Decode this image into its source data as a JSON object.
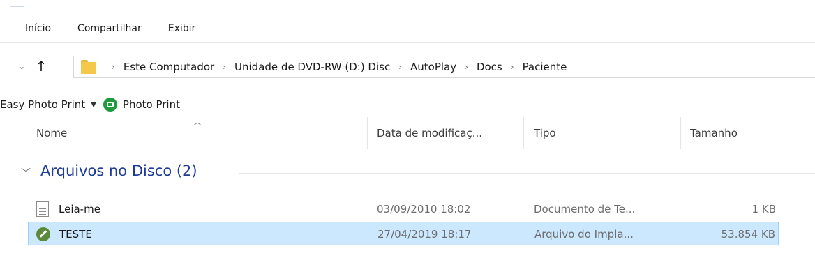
{
  "ribbon": {
    "tabs": [
      "Início",
      "Compartilhar",
      "Exibir"
    ]
  },
  "navigation": {
    "dropdown_icon": "chevron-down-icon",
    "up_icon": "up-arrow-icon",
    "breadcrumbs": [
      "Este Computador",
      "Unidade de DVD-RW (D:) Disc",
      "AutoPlay",
      "Docs",
      "Paciente"
    ]
  },
  "toolbar": {
    "easy_photo_print_label": "Easy Photo Print",
    "photo_print_label": "Photo Print",
    "photo_print_color": "#1e9b3c"
  },
  "columns": {
    "name": "Nome",
    "date": "Data de modificaç...",
    "type": "Tipo",
    "size": "Tamanho"
  },
  "group": {
    "title": "Arquivos no Disco (2)",
    "color": "#1f3b99"
  },
  "files": [
    {
      "name": "Leia-me",
      "date": "03/09/2010 18:02",
      "type": "Documento de Te...",
      "size": "1 KB",
      "icon": "text-document-icon",
      "selected": false
    },
    {
      "name": "TESTE",
      "date": "27/04/2019 18:17",
      "type": "Arquivo do Impla...",
      "size": "53.854 KB",
      "icon": "implant-file-icon",
      "selected": true
    }
  ],
  "colors": {
    "selection_bg": "#cce8ff",
    "selection_border": "#99d1ff"
  }
}
